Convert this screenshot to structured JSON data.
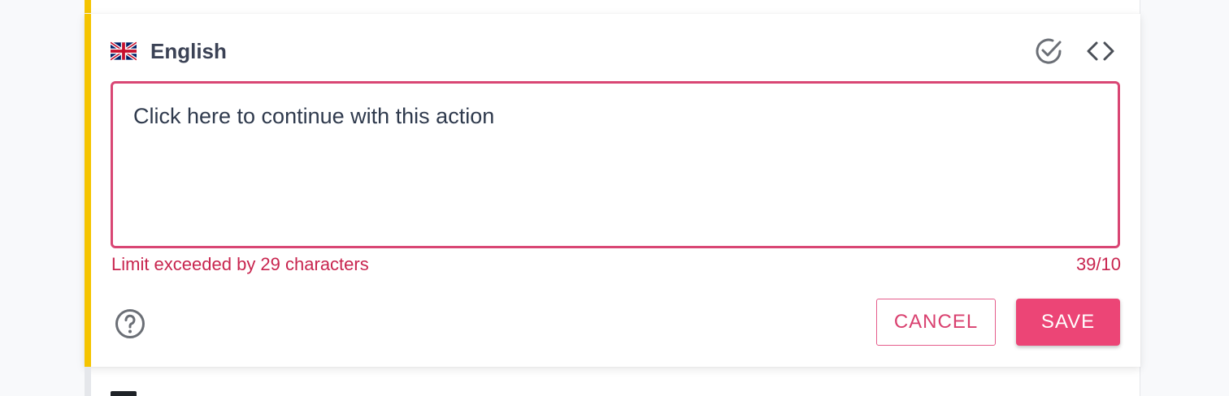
{
  "editor": {
    "language": {
      "label": "English",
      "flag_icon": "uk-flag-icon"
    },
    "toolbar": {
      "check_icon": "check-circle-icon",
      "code_icon": "code-brackets-icon"
    },
    "text_value": "Click here to continue with this action",
    "validation": {
      "error_message": "Limit exceeded by 29 characters",
      "counter": "39/10"
    },
    "footer": {
      "help_icon": "help-circle-icon",
      "cancel_label": "CANCEL",
      "save_label": "SAVE"
    }
  },
  "colors": {
    "accent_yellow": "#f5c400",
    "error_red": "#c8254f",
    "primary_pink": "#ec4576",
    "border_pink": "#d94674"
  }
}
